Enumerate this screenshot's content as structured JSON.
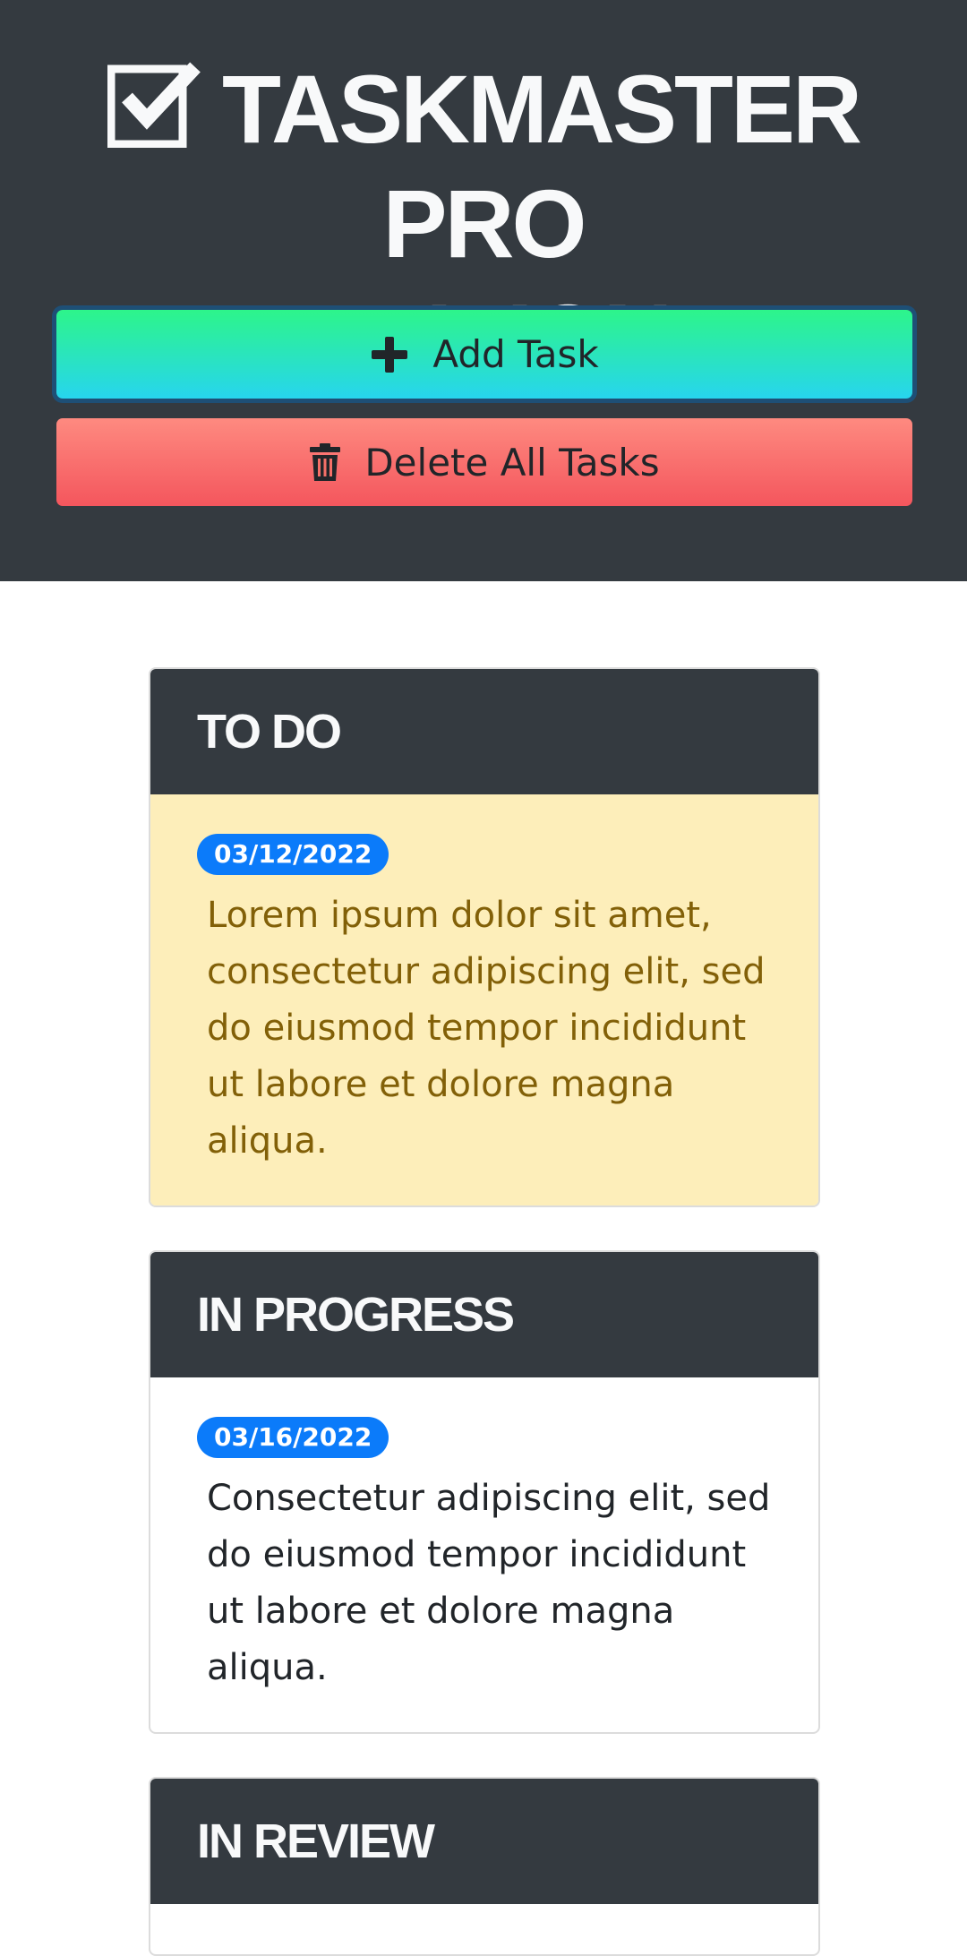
{
  "header": {
    "title_line1": "TASKMASTER PRO",
    "title_line2": "EDITION",
    "title_icon": "check-square-icon",
    "background": "#343a40"
  },
  "actions": {
    "add_label": "Add Task",
    "add_icon": "plus-icon",
    "delete_label": "Delete All Tasks",
    "delete_icon": "trash-icon"
  },
  "columns": [
    {
      "title": "TO DO",
      "tasks": [
        {
          "date": "03/12/2022",
          "text": "Lorem ipsum dolor sit amet, consectetur adipiscing elit, sed do eiusmod tempor incididunt ut labore et dolore magna aliqua.",
          "highlight": "#fdeeba"
        }
      ]
    },
    {
      "title": "IN PROGRESS",
      "tasks": [
        {
          "date": "03/16/2022",
          "text": "Consectetur adipiscing elit, sed do eiusmod tempor incididunt ut labore et dolore magna aliqua."
        }
      ]
    },
    {
      "title": "IN REVIEW",
      "tasks": []
    }
  ],
  "colors": {
    "badge": "#0b7bfa",
    "add_gradient": [
      "#2df58a",
      "#27d5ee"
    ],
    "delete_gradient": [
      "#fe8a80",
      "#f4565d"
    ]
  }
}
